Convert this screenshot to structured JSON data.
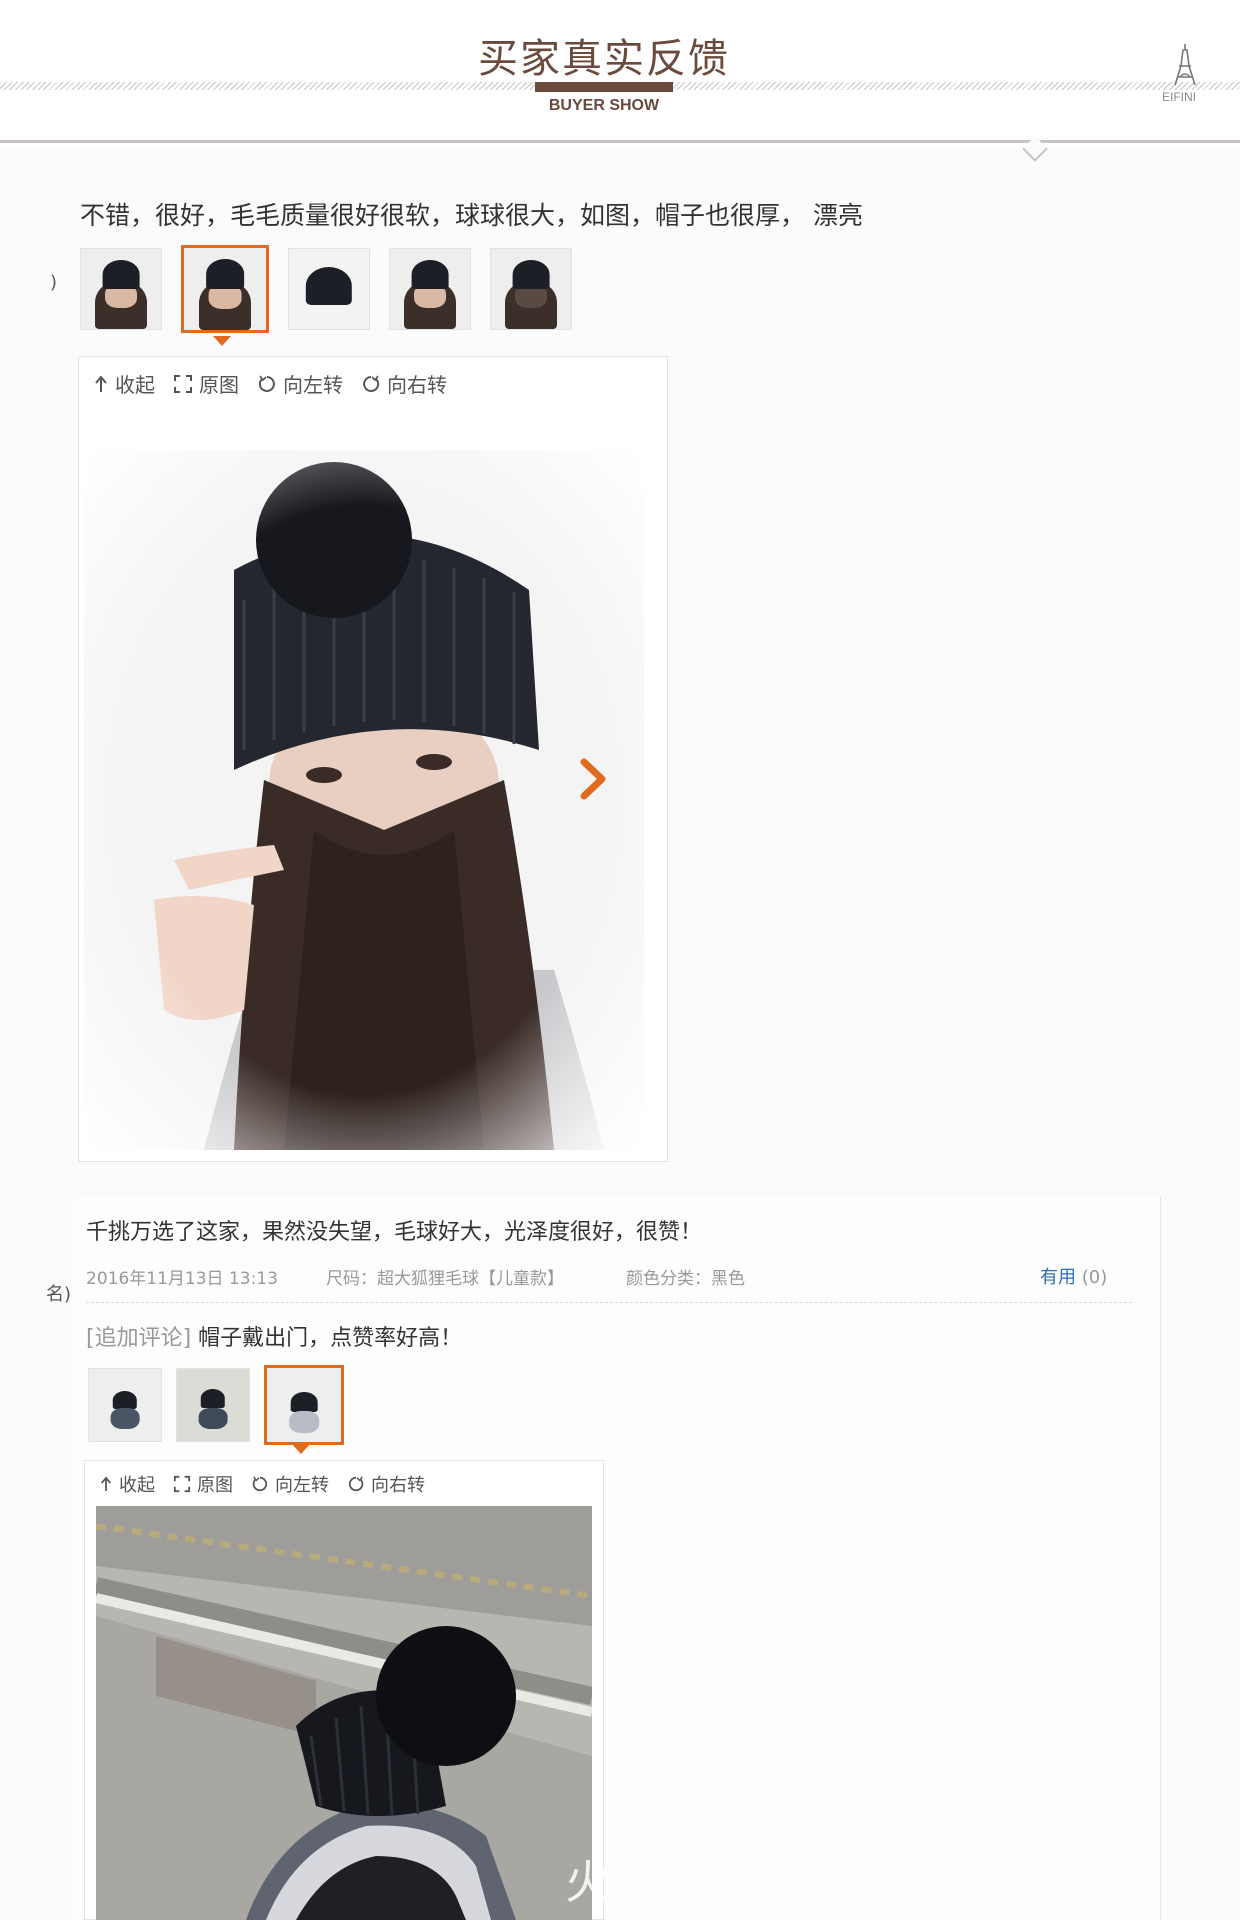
{
  "header": {
    "title_cn": "买家真实反馈",
    "title_en": "BUYER SHOW",
    "brand": "EIFINI"
  },
  "review1": {
    "text": "不错，很好，毛毛质量很好很软，球球很大，如图，帽子也很厚， 漂亮",
    "edge_char": ")",
    "thumb_count": 5,
    "selected_thumb": 2,
    "toolbar": [
      "收起",
      "原图",
      "向左转",
      "向右转"
    ]
  },
  "review2": {
    "text": "千挑万选了这家，果然没失望，毛球好大，光泽度很好，很赞！",
    "edge_char": "名)",
    "date": "2016年11月13日 13:13",
    "size": "尺码：超大狐狸毛球【儿童款】",
    "color": "颜色分类：黑色",
    "useful_label": "有用",
    "useful_count": "(0)",
    "append_label": "[追加评论]",
    "append_text": "帽子戴出门，点赞率好高！",
    "thumb_count": 3,
    "selected_thumb": 3,
    "toolbar": [
      "收起",
      "原图",
      "向左转",
      "向右转"
    ],
    "watermark": "火"
  },
  "colors": {
    "accent": "#e06b1f",
    "brand": "#6b4a3e",
    "link": "#2f6db3"
  }
}
